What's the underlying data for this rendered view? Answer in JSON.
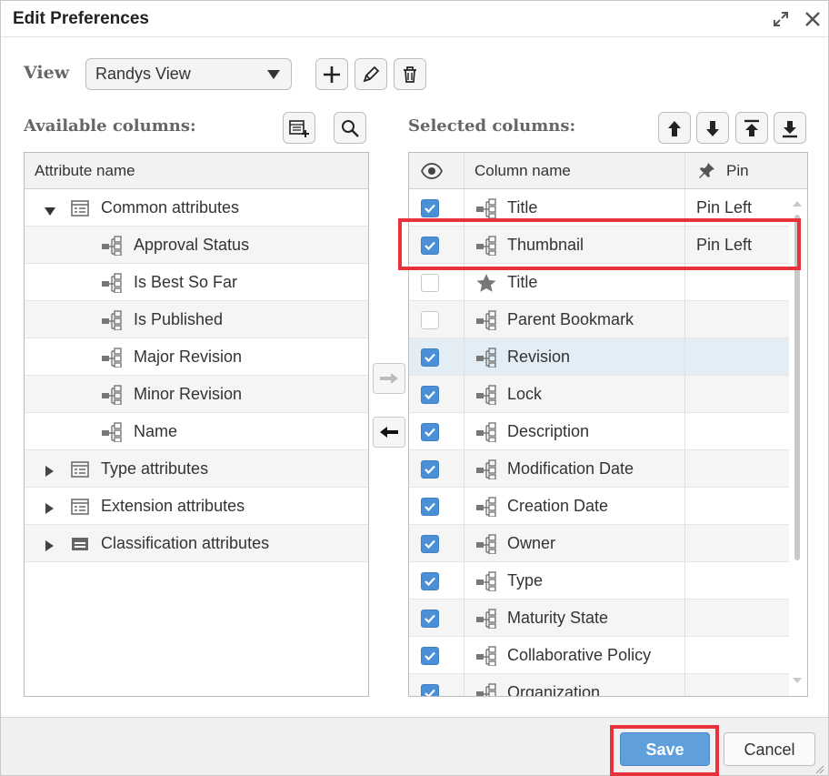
{
  "dialog": {
    "title": "Edit Preferences"
  },
  "view": {
    "label": "View",
    "selected": "Randys View"
  },
  "available": {
    "label": "Available columns:",
    "header": "Attribute name",
    "items": [
      {
        "label": "Common attributes",
        "kind": "group",
        "expanded": true
      },
      {
        "label": "Approval Status",
        "kind": "attr"
      },
      {
        "label": "Is Best So Far",
        "kind": "attr"
      },
      {
        "label": "Is Published",
        "kind": "attr"
      },
      {
        "label": "Major Revision",
        "kind": "attr"
      },
      {
        "label": "Minor Revision",
        "kind": "attr"
      },
      {
        "label": "Name",
        "kind": "attr"
      },
      {
        "label": "Type attributes",
        "kind": "group",
        "expanded": false
      },
      {
        "label": "Extension attributes",
        "kind": "group",
        "expanded": false
      },
      {
        "label": "Classification attributes",
        "kind": "group",
        "expanded": false
      }
    ]
  },
  "selected": {
    "label": "Selected columns:",
    "header_col": "Column name",
    "header_pin": "Pin",
    "rows": [
      {
        "name": "Title",
        "checked": true,
        "pin": "Pin Left",
        "icon": "attribute-icon"
      },
      {
        "name": "Thumbnail",
        "checked": true,
        "pin": "Pin Left",
        "icon": "attribute-icon"
      },
      {
        "name": "Title",
        "checked": false,
        "pin": "",
        "icon": "star-icon"
      },
      {
        "name": "Parent Bookmark",
        "checked": false,
        "pin": "",
        "icon": "attribute-icon"
      },
      {
        "name": "Revision",
        "checked": true,
        "pin": "",
        "icon": "attribute-icon"
      },
      {
        "name": "Lock",
        "checked": true,
        "pin": "",
        "icon": "attribute-icon"
      },
      {
        "name": "Description",
        "checked": true,
        "pin": "",
        "icon": "attribute-icon"
      },
      {
        "name": "Modification Date",
        "checked": true,
        "pin": "",
        "icon": "attribute-icon"
      },
      {
        "name": "Creation Date",
        "checked": true,
        "pin": "",
        "icon": "attribute-icon"
      },
      {
        "name": "Owner",
        "checked": true,
        "pin": "",
        "icon": "attribute-icon"
      },
      {
        "name": "Type",
        "checked": true,
        "pin": "",
        "icon": "attribute-icon"
      },
      {
        "name": "Maturity State",
        "checked": true,
        "pin": "",
        "icon": "attribute-icon"
      },
      {
        "name": "Collaborative Policy",
        "checked": true,
        "pin": "",
        "icon": "attribute-icon"
      },
      {
        "name": "Organization",
        "checked": true,
        "pin": "",
        "icon": "attribute-icon"
      }
    ]
  },
  "buttons": {
    "save": "Save",
    "cancel": "Cancel"
  },
  "colors": {
    "accent": "#5f9fdb",
    "checkbox": "#4b8fd6",
    "highlight": "#e8323c",
    "selected_row": "#e3edf6"
  }
}
